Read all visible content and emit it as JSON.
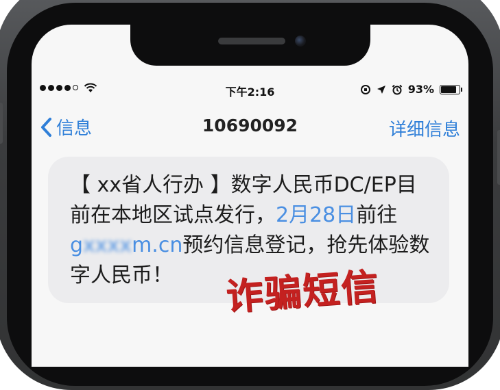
{
  "status_bar": {
    "time": "下午2:16",
    "battery_percent": "93%",
    "battery_level": 0.93,
    "signal_bars_filled": 4,
    "signal_bars_total": 5
  },
  "nav": {
    "back_label": "信息",
    "title": "10690092",
    "detail_label": "详细信息"
  },
  "message": {
    "line1": "【 xx省人行办 】数字人民币DC/EP目",
    "line2_part1": "前在本地区试点发行，",
    "line2_link": "2月28日",
    "line2_part2": "前往",
    "line3_link_start": "g",
    "line3_link_blurred": "xxxx",
    "line3_link_end": "m.cn",
    "line3_rest": "预约信息登记，抢先体验数",
    "line4": "字人民币！"
  },
  "stamp": {
    "text": "诈骗短信"
  },
  "colors": {
    "link": "#4a8fe2",
    "ios_blue": "#2f7fd8",
    "stamp_red": "#c42120"
  },
  "icons": [
    "signal-dots-icon",
    "wifi-icon",
    "location-icon",
    "alarm-icon",
    "rotation-lock-icon",
    "battery-icon",
    "back-chevron-icon"
  ]
}
